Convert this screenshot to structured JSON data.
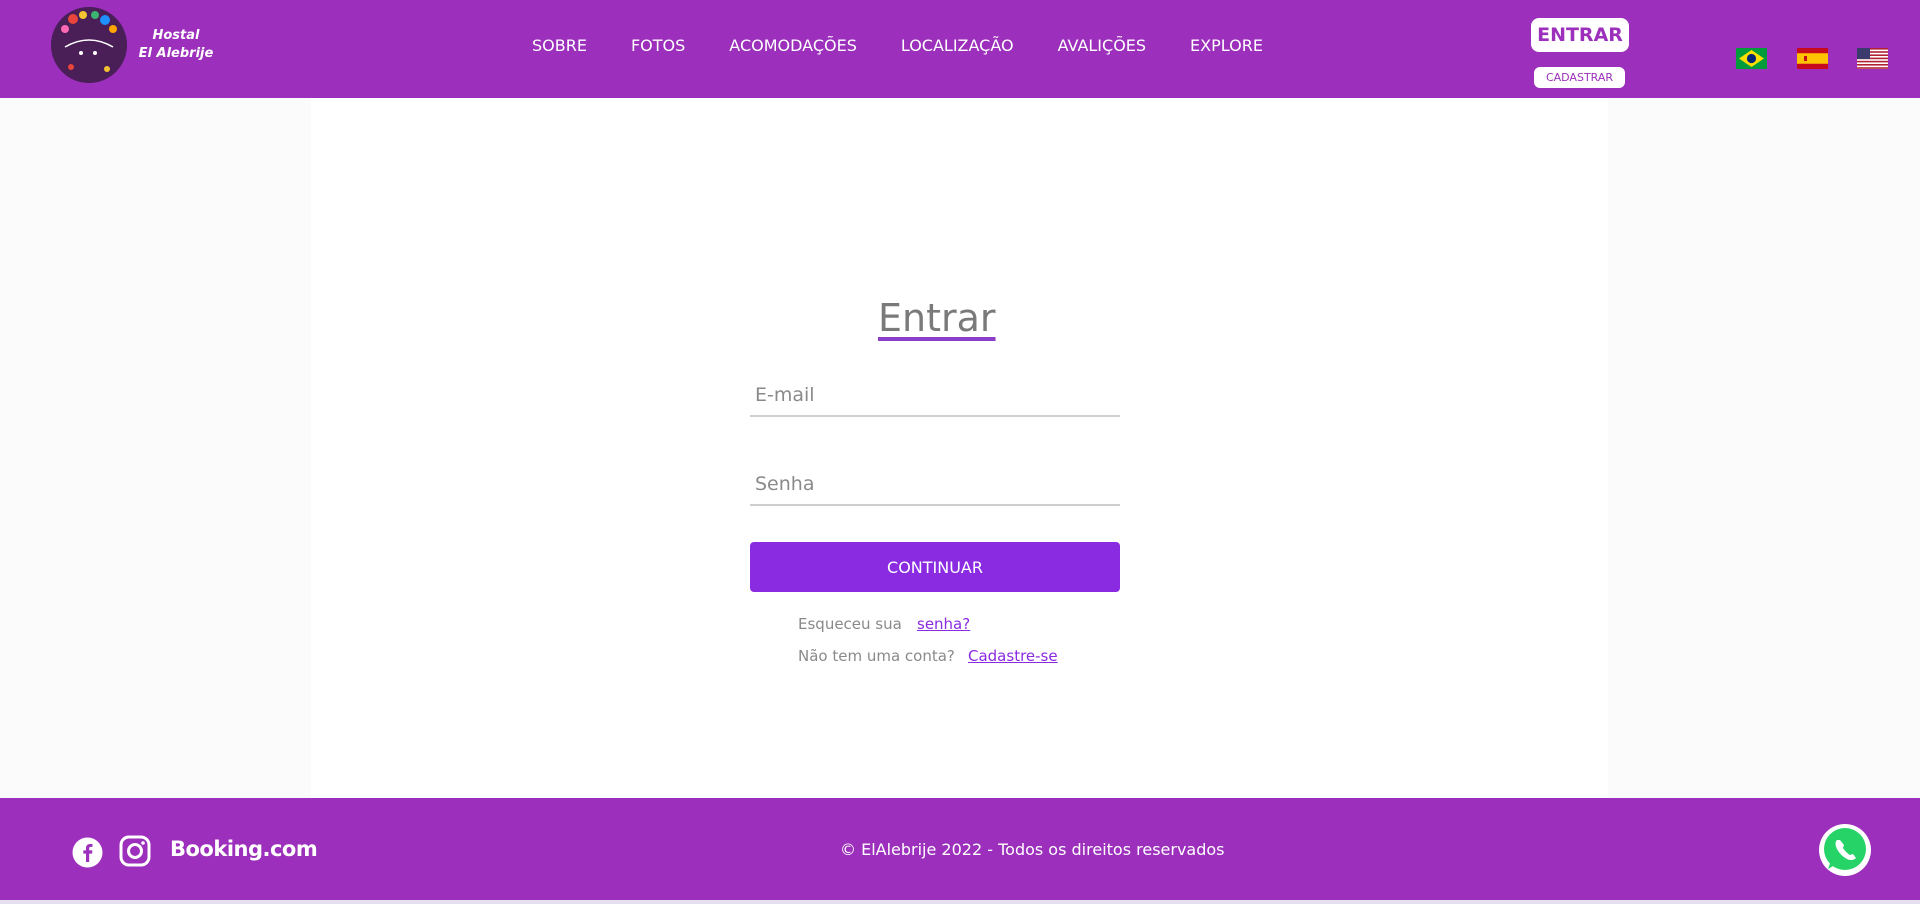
{
  "header": {
    "brand_line1": "Hostal",
    "brand_line2": "El Alebrije",
    "nav": [
      "SOBRE",
      "FOTOS",
      "ACOMODAÇÕES",
      "LOCALIZAÇÃO",
      "AVALIÇÕES",
      "EXPLORE"
    ],
    "login_button": "ENTRAR",
    "signup_button": "CADASTRAR",
    "flags": [
      "brazil-flag-icon",
      "spain-flag-icon",
      "usa-flag-icon"
    ]
  },
  "login": {
    "title": "Entrar",
    "email_placeholder": "E-mail",
    "password_placeholder": "Senha",
    "continue_button": "CONTINUAR",
    "forgot_text": "Esqueceu sua",
    "forgot_link": "senha?",
    "no_account_text": "Não tem uma conta?",
    "signup_link": "Cadastre-se"
  },
  "footer": {
    "booking": "Booking.com",
    "copyright": "© ElAlebrije 2022 - Todos os direitos reservados",
    "icons": [
      "facebook-icon",
      "instagram-icon",
      "whatsapp-icon"
    ]
  },
  "colors": {
    "brand_purple": "#9c2fbb",
    "button_purple": "#8a2be2",
    "background": "#fbfbfb"
  }
}
